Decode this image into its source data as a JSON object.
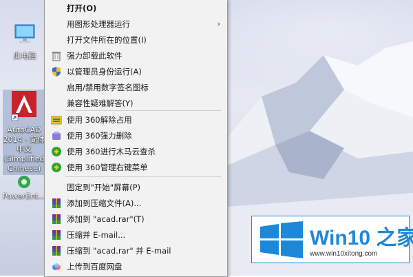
{
  "desktop": {
    "icons": [
      {
        "label": "此电脑"
      },
      {
        "label": "AutoCAD\n2014 - 简体\n中文\n(Simplified\nChinese)"
      },
      {
        "label": "PowerEnt..."
      }
    ]
  },
  "menu": {
    "items": [
      {
        "label": "打开(O)",
        "icon": "none"
      },
      {
        "label": "用图形处理器运行",
        "icon": "none",
        "submenu": "›"
      },
      {
        "label": "打开文件所在的位置(I)",
        "icon": "none"
      },
      {
        "label": "强力卸载此软件",
        "icon": "trash-icon"
      },
      {
        "label": "以管理员身份运行(A)",
        "icon": "uac-shield-icon"
      },
      {
        "label": "启用/禁用数字签名图标",
        "icon": "none"
      },
      {
        "label": "兼容性疑难解答(Y)",
        "icon": "none"
      },
      {
        "label": "使用 360解除占用",
        "icon": "360-unlock-icon"
      },
      {
        "label": "使用 360强力删除",
        "icon": "360-delete-icon"
      },
      {
        "label": "使用 360进行木马云查杀",
        "icon": "360-scan-icon"
      },
      {
        "label": "使用 360管理右键菜单",
        "icon": "360-menu-icon"
      },
      {
        "label": "固定到\"开始\"屏幕(P)",
        "icon": "none"
      },
      {
        "label": "添加到压缩文件(A)...",
        "icon": "winrar-icon"
      },
      {
        "label": "添加到 \"acad.rar\"(T)",
        "icon": "winrar-icon"
      },
      {
        "label": "压缩并 E-mail...",
        "icon": "winrar-icon"
      },
      {
        "label": "压缩到 \"acad.rar\" 并 E-mail",
        "icon": "winrar-icon"
      },
      {
        "label": "上传到百度网盘",
        "icon": "baidu-netdisk-icon"
      }
    ]
  },
  "watermark": {
    "title": "Win10 之家",
    "url": "www.win10xitong.com",
    "color": "#1e88d8"
  }
}
